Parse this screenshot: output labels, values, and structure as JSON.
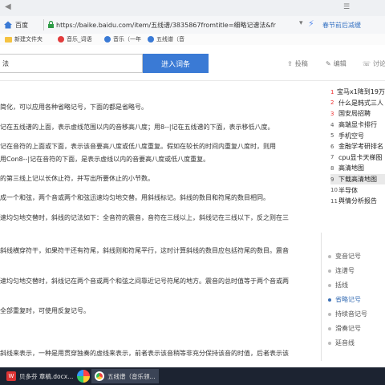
{
  "browser": {
    "title_right": "☰",
    "home_label": "百度",
    "url": "https://baike.baidu.com/item/五线谱/3835867fromtitle=细略记谱法&fr",
    "news_text": "春节前后减缓"
  },
  "bookmarks": [
    {
      "label": "新建文件夹",
      "kind": "folder",
      "color": "#f5c342"
    },
    {
      "label": "音乐_词语",
      "kind": "site",
      "color": "#e23c3c"
    },
    {
      "label": "音乐（一年",
      "kind": "site",
      "color": "#3a7ad5"
    },
    {
      "label": "五线谱（音",
      "kind": "site",
      "color": "#3a7ad5"
    }
  ],
  "search": {
    "query": "法",
    "button": "进入词条",
    "tools": [
      "投稿",
      "编辑",
      "讨论"
    ]
  },
  "article": {
    "paragraphs": [
      "简化，可以应用各种省略记号，下面的都是省略号。",
      "记在五线谱的上面，表示虚线范围以内的音移高八度；用8--|记在五线谱的下面，表示移低八度。",
      "记在音符的上面或下面，表示该音要高八度或低八度重复。假如在较长的时间内重复八度时，则用",
      "用Con8--|记在音符的下面，是表示虚线以内的音要高八度或低八度重复。",
      "的第三线上记以长休止符，并写出所要休止的小节数。",
      "成一个和弦，两个音或两个和弦迅速均匀地交替。用斜线标记。斜线的数目和符尾的数目相同。",
      "速均匀地交替时，斜线的记法如下：全音符的震音，音符在三线以上，斜线记在三线以下，反之则在三",
      "",
      "斜线横穿符干，如果符干还有符尾，斜线则和符尾平行，这时计算斜线的数目应包括符尾的数目。震音",
      "",
      "速均匀地交替时，斜线记在两个音或两个和弦之间靠近记号符尾的地方。震音的总时值等于两个音或两",
      "",
      "全部重复时，可使用反复记号。",
      "",
      "斜线来表示，一种是用贯穿独奏的虚线来表示，前者表示该音稍等非充分保持该音的时值，后者表示该"
    ],
    "links": [
      "和弦"
    ]
  },
  "hot_list": [
    {
      "n": "1",
      "label": "宝马x1降到19万"
    },
    {
      "n": "2",
      "label": "什么是韩式三人"
    },
    {
      "n": "3",
      "label": "国安局招聘"
    },
    {
      "n": "4",
      "label": "高端显卡排行"
    },
    {
      "n": "5",
      "label": "手机空号"
    },
    {
      "n": "6",
      "label": "金融学考研排名"
    },
    {
      "n": "7",
      "label": "cpu显卡天梯图"
    },
    {
      "n": "8",
      "label": "高清地图"
    },
    {
      "n": "9",
      "label": "下载高清地图"
    },
    {
      "n": "10",
      "label": "半导体"
    },
    {
      "n": "11",
      "label": "舆情分析报告"
    }
  ],
  "toc": [
    {
      "label": "变音记号",
      "active": false
    },
    {
      "label": "连谱号",
      "active": false
    },
    {
      "label": "括线",
      "active": false
    },
    {
      "label": "省略记号",
      "active": true
    },
    {
      "label": "持续音记号",
      "active": false
    },
    {
      "label": "滑奏记号",
      "active": false
    },
    {
      "label": "延音线",
      "active": false
    }
  ],
  "taskbar": {
    "item1": "贝多芬 章稿.docx...",
    "item2": "五线谱（音乐领..."
  }
}
